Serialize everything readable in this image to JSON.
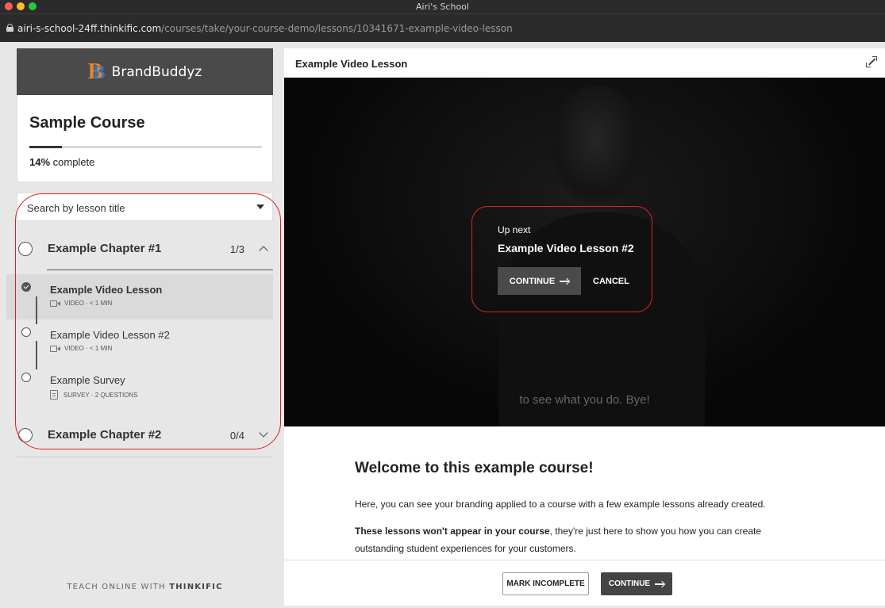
{
  "window": {
    "title": "Airi's School",
    "url_host": "airi-s-school-24ff.thinkific.com",
    "url_path": "/courses/take/your-course-demo/lessons/10341671-example-video-lesson"
  },
  "sidebar": {
    "brand_name": "BrandBuddyz",
    "course_title": "Sample Course",
    "progress_percent": 14,
    "progress_value": "14%",
    "progress_suffix": " complete",
    "search_placeholder": "Search by lesson title",
    "chapters": [
      {
        "title": "Example Chapter #1",
        "count": "1/3",
        "expanded": true,
        "lessons": [
          {
            "title": "Example Video Lesson",
            "meta": "VIDEO · < 1 MIN",
            "icon": "video-icon",
            "completed": true,
            "active": true
          },
          {
            "title": "Example Video Lesson #2",
            "meta": "VIDEO · < 1 MIN",
            "icon": "video-icon",
            "completed": false,
            "active": false
          },
          {
            "title": "Example Survey",
            "meta": "SURVEY · 2 QUESTIONS",
            "icon": "survey-icon",
            "completed": false,
            "active": false
          }
        ]
      },
      {
        "title": "Example Chapter #2",
        "count": "0/4",
        "expanded": false
      }
    ],
    "footer_prefix": "TEACH ONLINE WITH ",
    "footer_brand": "THINKIFIC"
  },
  "main": {
    "lesson_title": "Example Video Lesson",
    "video": {
      "up_next_label": "Up next",
      "up_next_title": "Example Video Lesson #2",
      "continue_label": "CONTINUE",
      "cancel_label": "CANCEL",
      "caption": "to see what you do. Bye!"
    },
    "content": {
      "heading": "Welcome to this example course!",
      "paragraph1": "Here, you can see your branding applied to a course with a few example lessons already created.",
      "paragraph2_bold": "These lessons won't appear in your course",
      "paragraph2_rest": ", they're just here to show you how you can create outstanding student experiences for your customers."
    },
    "footer": {
      "mark_incomplete_label": "MARK INCOMPLETE",
      "continue_label": "CONTINUE"
    }
  },
  "colors": {
    "highlight": "#e02020",
    "brand_bar": "#4a4a4a",
    "logo_orange": "#e6862d",
    "logo_blue": "#3a7bbf"
  }
}
